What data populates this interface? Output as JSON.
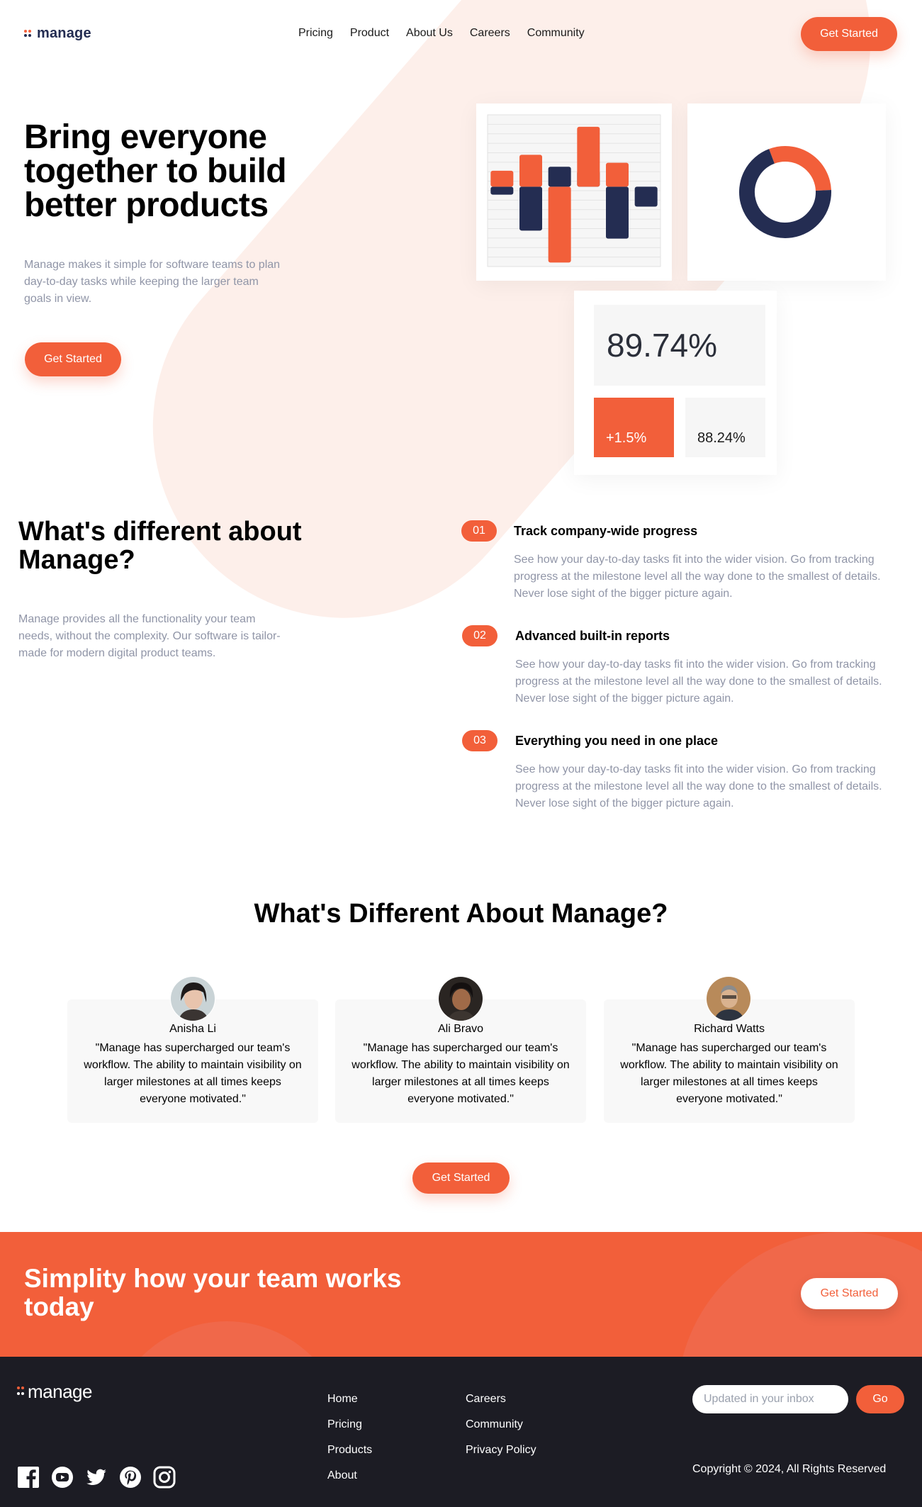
{
  "colors": {
    "accent": "#f25f3a",
    "navy": "#242d52",
    "text_muted": "#9095a7",
    "footer_bg": "#1c1c24"
  },
  "header": {
    "logo_text": "manage",
    "nav": [
      "Pricing",
      "Product",
      "About Us",
      "Careers",
      "Community"
    ],
    "cta_label": "Get Started"
  },
  "hero": {
    "title": "Bring everyone together to build better products",
    "subtitle": "Manage makes it simple for software teams to plan day-to-day tasks while keeping the larger team goals in view.",
    "cta_label": "Get Started",
    "stats": {
      "main": "89.74%",
      "change": "+1.5%",
      "secondary": "88.24%"
    }
  },
  "chart_data": [
    {
      "type": "bar",
      "categories": [
        "",
        "",
        "",
        "",
        "",
        ""
      ],
      "series": [
        {
          "values": [
            4,
            8,
            5,
            15,
            6,
            0
          ]
        },
        {
          "values": [
            -2,
            -11,
            -19,
            4,
            -13,
            -5
          ]
        }
      ],
      "ylim": [
        -20,
        18
      ],
      "grid": true
    },
    {
      "type": "pie",
      "donut": true,
      "values": [
        30,
        70
      ]
    }
  ],
  "features": {
    "title": "What's different about Manage?",
    "subtitle": "Manage provides all the functionality your team needs, without the complexity. Our software is tailor-made for modern digital product teams.",
    "items": [
      {
        "number": "01",
        "title": "Track company-wide progress",
        "text": "See how your day-to-day tasks fit into the wider vision. Go from tracking progress at the milestone level all the way done to the smallest of details. Never lose sight of the bigger picture again."
      },
      {
        "number": "02",
        "title": "Advanced built-in reports",
        "text": "See how your day-to-day tasks fit into the wider vision. Go from tracking progress at the milestone level all the way done to the smallest of details. Never lose sight of the bigger picture again."
      },
      {
        "number": "03",
        "title": "Everything you need in one place",
        "text": "See how your day-to-day tasks fit into the wider vision. Go from tracking progress at the milestone level all the way done to the smallest of details. Never lose sight of the bigger picture again."
      }
    ]
  },
  "testimonials": {
    "title": "What's Different About Manage?",
    "items": [
      {
        "name": "Anisha Li",
        "quote": "\"Manage has supercharged our team's workflow. The ability to maintain visibility on larger milestones at all times keeps everyone motivated.\""
      },
      {
        "name": "Ali Bravo",
        "quote": "\"Manage has supercharged our team's workflow. The ability to maintain visibility on larger milestones at all times keeps everyone motivated.\""
      },
      {
        "name": "Richard Watts",
        "quote": "\"Manage has supercharged our team's workflow. The ability to maintain visibility on larger milestones at all times keeps everyone motivated.\""
      }
    ],
    "cta_label": "Get Started"
  },
  "cta": {
    "title": "Simplity how your team works today",
    "button_label": "Get Started"
  },
  "footer": {
    "logo_text": "manage",
    "links_col1": [
      "Home",
      "Pricing",
      "Products",
      "About"
    ],
    "links_col2": [
      "Careers",
      "Community",
      "Privacy Policy"
    ],
    "social_icons": [
      "facebook-icon",
      "youtube-icon",
      "twitter-icon",
      "pinterest-icon",
      "instagram-icon"
    ],
    "newsletter_placeholder": "Updated in your inbox",
    "go_label": "Go",
    "copyright": "Copyright © 2024, All Rights Reserved"
  }
}
